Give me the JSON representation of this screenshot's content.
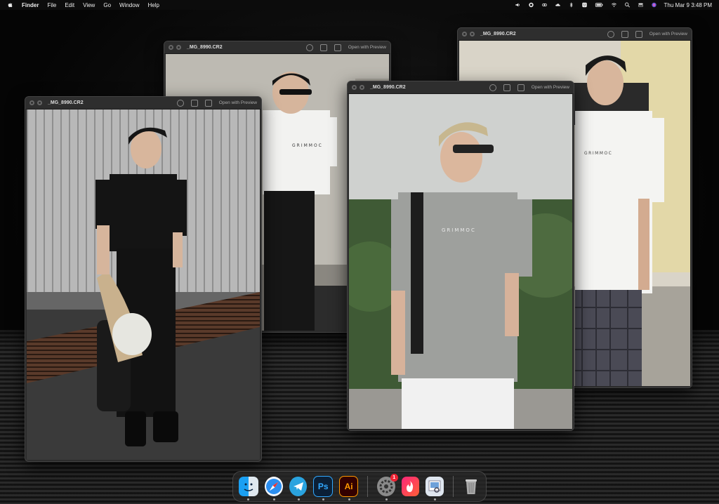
{
  "menubar": {
    "apple_icon": "apple-icon",
    "app_name": "Finder",
    "menus": [
      "File",
      "Edit",
      "View",
      "Go",
      "Window",
      "Help"
    ],
    "status_icons": [
      "volume-icon",
      "chat-icon",
      "creative-cloud-icon",
      "cloud-icon",
      "bluetooth-icon",
      "keyboard-icon",
      "battery-icon",
      "wifi-icon",
      "search-icon",
      "control-center-icon",
      "siri-icon"
    ],
    "datetime": "Thu Mar 9  3:48 PM"
  },
  "windows": [
    {
      "title": "_MG_8990.CR2",
      "open_with": "Open with Preview"
    },
    {
      "title": "_MG_8990.CR2",
      "open_with": "Open with Preview"
    },
    {
      "title": "_MG_8990.CR2",
      "open_with": "Open with Preview"
    },
    {
      "title": "_MG_8990.CR2",
      "open_with": "Open with Preview"
    }
  ],
  "photo_prints": {
    "shirt_text": "GRIMMOC"
  },
  "dock": {
    "items": [
      {
        "name": "finder",
        "label": "",
        "color": "#3a8ee6"
      },
      {
        "name": "safari",
        "label": "",
        "color": "#1e88e5"
      },
      {
        "name": "telegram",
        "label": "",
        "color": "#2aa3df"
      },
      {
        "name": "photoshop",
        "label": "Ps",
        "color": "#0b2037"
      },
      {
        "name": "illustrator",
        "label": "Ai",
        "color": "#330000"
      },
      {
        "name": "system-settings",
        "label": "",
        "color": "#7a7a7a",
        "badge": "1"
      },
      {
        "name": "tinder",
        "label": "",
        "color": "#fd5068"
      },
      {
        "name": "preview",
        "label": "",
        "color": "#cfd8e6"
      },
      {
        "name": "trash",
        "label": "",
        "color": "#999999"
      }
    ]
  }
}
